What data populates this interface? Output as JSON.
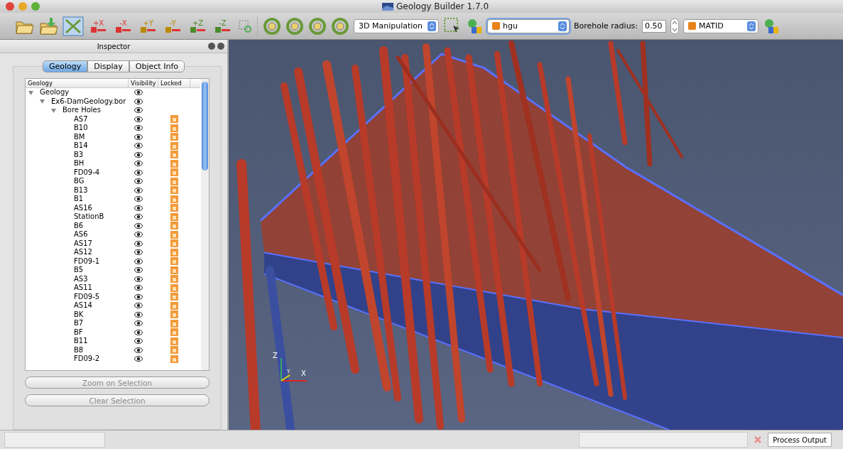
{
  "window": {
    "title": "Geology Builder 1.7.0"
  },
  "toolbar": {
    "axis_buttons": [
      {
        "label": "+X",
        "kind": "x"
      },
      {
        "label": "-X",
        "kind": "x"
      },
      {
        "label": "+Y",
        "kind": "y"
      },
      {
        "label": "-Y",
        "kind": "y"
      },
      {
        "label": "+Z",
        "kind": "z"
      },
      {
        "label": "-Z",
        "kind": "z"
      }
    ],
    "mode": "3D Manipulation",
    "property": "hgu",
    "radius_label": "Borehole radius:",
    "radius": "0.50",
    "material": "MATID"
  },
  "inspector": {
    "title": "Inspector",
    "tabs": [
      {
        "label": "Geology",
        "selected": true
      },
      {
        "label": "Display",
        "selected": false
      },
      {
        "label": "Object Info",
        "selected": false
      }
    ],
    "columns": [
      "Geology",
      "Visibility",
      "Locked"
    ],
    "tree": [
      {
        "name": "Geology",
        "visible": true,
        "expanded": true,
        "children": [
          {
            "name": "Ex6-DamGeology.bor",
            "visible": true,
            "expanded": true,
            "children": [
              {
                "name": "Bore Holes",
                "visible": true,
                "expanded": true,
                "children": [
                  {
                    "name": "AS7",
                    "visible": true,
                    "locked": true
                  },
                  {
                    "name": "B10",
                    "visible": true,
                    "locked": true
                  },
                  {
                    "name": "BM",
                    "visible": true,
                    "locked": true
                  },
                  {
                    "name": "B14",
                    "visible": true,
                    "locked": true
                  },
                  {
                    "name": "B3",
                    "visible": true,
                    "locked": true
                  },
                  {
                    "name": "BH",
                    "visible": true,
                    "locked": true
                  },
                  {
                    "name": "FD09-4",
                    "visible": true,
                    "locked": true
                  },
                  {
                    "name": "BG",
                    "visible": true,
                    "locked": true
                  },
                  {
                    "name": "B13",
                    "visible": true,
                    "locked": true
                  },
                  {
                    "name": "B1",
                    "visible": true,
                    "locked": true
                  },
                  {
                    "name": "AS16",
                    "visible": true,
                    "locked": true
                  },
                  {
                    "name": "StationB",
                    "visible": true,
                    "locked": true
                  },
                  {
                    "name": "B6",
                    "visible": true,
                    "locked": true
                  },
                  {
                    "name": "AS6",
                    "visible": true,
                    "locked": true
                  },
                  {
                    "name": "AS17",
                    "visible": true,
                    "locked": true
                  },
                  {
                    "name": "AS12",
                    "visible": true,
                    "locked": true
                  },
                  {
                    "name": "FD09-1",
                    "visible": true,
                    "locked": true
                  },
                  {
                    "name": "B5",
                    "visible": true,
                    "locked": true
                  },
                  {
                    "name": "AS3",
                    "visible": true,
                    "locked": true
                  },
                  {
                    "name": "AS11",
                    "visible": true,
                    "locked": true
                  },
                  {
                    "name": "FD09-5",
                    "visible": true,
                    "locked": true
                  },
                  {
                    "name": "AS14",
                    "visible": true,
                    "locked": true
                  },
                  {
                    "name": "BK",
                    "visible": true,
                    "locked": true
                  },
                  {
                    "name": "B7",
                    "visible": true,
                    "locked": true
                  },
                  {
                    "name": "BF",
                    "visible": true,
                    "locked": true
                  },
                  {
                    "name": "B11",
                    "visible": true,
                    "locked": true
                  },
                  {
                    "name": "B8",
                    "visible": true,
                    "locked": true
                  },
                  {
                    "name": "FD09-2",
                    "visible": true,
                    "locked": true
                  }
                ]
              }
            ]
          }
        ]
      }
    ],
    "buttons": [
      {
        "label": "Zoom on Selection",
        "disabled": true
      },
      {
        "label": "Clear Selection",
        "disabled": true
      }
    ]
  },
  "viewport": {
    "axes": {
      "z": "Z",
      "y": "Y",
      "x": "X"
    }
  },
  "status_bar": {
    "process_button": "Process Output"
  }
}
